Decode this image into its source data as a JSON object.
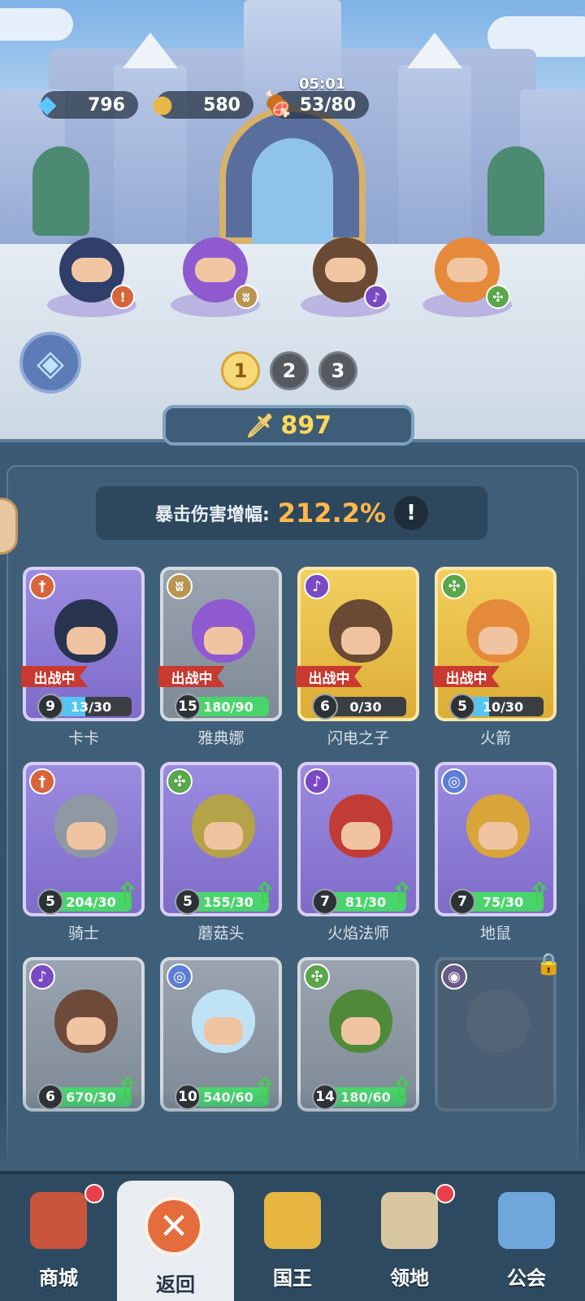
{
  "resources": {
    "gems": {
      "icon": "diamond-icon",
      "value": "796"
    },
    "gold": {
      "icon": "gold-coin-icon",
      "value": "580"
    },
    "stamina": {
      "icon": "meat-icon",
      "value": "53/80",
      "timer": "05:01"
    }
  },
  "squad": [
    {
      "name": "卡卡",
      "class_icon": "exclaim-class-icon",
      "color": "#2f3f6a"
    },
    {
      "name": "雅典娜",
      "class_icon": "wing-class-icon",
      "color": "#8f5ad0"
    },
    {
      "name": "闪电之子",
      "class_icon": "staff-class-icon",
      "color": "#6b4a34"
    },
    {
      "name": "火箭",
      "class_icon": "target-class-icon",
      "color": "#e58a3b"
    }
  ],
  "pages": [
    "1",
    "2",
    "3"
  ],
  "power": {
    "value": "897"
  },
  "crit": {
    "label": "暴击伤害增幅:",
    "value": "212.2%",
    "info": "!"
  },
  "heroes": [
    {
      "name": "卡卡",
      "level": "9",
      "progress": "13/30",
      "ratio": 0.43,
      "rarity": "purple",
      "class_icon": "sword-class-icon",
      "class_color": "#d8643a",
      "deployed": true,
      "deployed_label": "出战中",
      "upgrade": false,
      "body_color": "#28344f"
    },
    {
      "name": "雅典娜",
      "level": "15",
      "progress": "180/90",
      "ratio": 1,
      "rarity": "gray",
      "class_icon": "wing-class-icon",
      "class_color": "#b99550",
      "deployed": true,
      "deployed_label": "出战中",
      "upgrade": false,
      "body_color": "#8f5ad0"
    },
    {
      "name": "闪电之子",
      "level": "6",
      "progress": "0/30",
      "ratio": 0,
      "rarity": "gold",
      "class_icon": "staff-class-icon",
      "class_color": "#7a4ac4",
      "deployed": true,
      "deployed_label": "出战中",
      "upgrade": false,
      "body_color": "#6b4a34"
    },
    {
      "name": "火箭",
      "level": "5",
      "progress": "10/30",
      "ratio": 0.33,
      "rarity": "gold",
      "class_icon": "target-class-icon",
      "class_color": "#5aa64a",
      "deployed": true,
      "deployed_label": "出战中",
      "upgrade": false,
      "body_color": "#e58a3b"
    },
    {
      "name": "骑士",
      "level": "5",
      "progress": "204/30",
      "ratio": 1,
      "rarity": "purple",
      "class_icon": "sword-class-icon",
      "class_color": "#d8643a",
      "deployed": false,
      "upgrade": true,
      "body_color": "#8f98a3"
    },
    {
      "name": "蘑菇头",
      "level": "5",
      "progress": "155/30",
      "ratio": 1,
      "rarity": "purple",
      "class_icon": "target-class-icon",
      "class_color": "#5aa64a",
      "deployed": false,
      "upgrade": true,
      "body_color": "#b5a34a"
    },
    {
      "name": "火焰法师",
      "level": "7",
      "progress": "81/30",
      "ratio": 1,
      "rarity": "purple",
      "class_icon": "staff-class-icon",
      "class_color": "#7a4ac4",
      "deployed": false,
      "upgrade": true,
      "body_color": "#c13c34"
    },
    {
      "name": "地鼠",
      "level": "7",
      "progress": "75/30",
      "ratio": 1,
      "rarity": "purple",
      "class_icon": "swirl-class-icon",
      "class_color": "#5c7ed6",
      "deployed": false,
      "upgrade": true,
      "body_color": "#d9a43a"
    },
    {
      "name": "",
      "level": "6",
      "progress": "670/30",
      "ratio": 1,
      "rarity": "gray",
      "class_icon": "staff-class-icon",
      "class_color": "#7a4ac4",
      "deployed": false,
      "upgrade": true,
      "body_color": "#6d4a3a"
    },
    {
      "name": "",
      "level": "10",
      "progress": "540/60",
      "ratio": 1,
      "rarity": "gray",
      "class_icon": "swirl-class-icon",
      "class_color": "#5c7ed6",
      "deployed": false,
      "upgrade": true,
      "body_color": "#bfe3f5"
    },
    {
      "name": "",
      "level": "14",
      "progress": "180/60",
      "ratio": 1,
      "rarity": "gray",
      "class_icon": "target-class-icon",
      "class_color": "#5aa64a",
      "deployed": false,
      "upgrade": true,
      "body_color": "#4f8a3a"
    },
    {
      "name": "",
      "level": "",
      "progress": "",
      "ratio": 0,
      "rarity": "locked",
      "class_icon": "eye-class-icon",
      "class_color": "#6a5a8a",
      "deployed": false,
      "upgrade": false,
      "locked": true,
      "body_color": "#5d6c7c"
    }
  ],
  "nav": [
    {
      "label": "商城",
      "icon": "shop-icon",
      "badge": true,
      "active": false,
      "color": "#c9553d"
    },
    {
      "label": "返回",
      "icon": "close-icon",
      "badge": false,
      "active": true,
      "color": "#e56d3d"
    },
    {
      "label": "国王",
      "icon": "crown-icon",
      "badge": false,
      "active": false,
      "color": "#e7b640"
    },
    {
      "label": "领地",
      "icon": "castle-icon",
      "badge": true,
      "active": false,
      "color": "#d8c7a0"
    },
    {
      "label": "公会",
      "icon": "planet-icon",
      "badge": false,
      "active": false,
      "color": "#6fa7dd"
    }
  ]
}
